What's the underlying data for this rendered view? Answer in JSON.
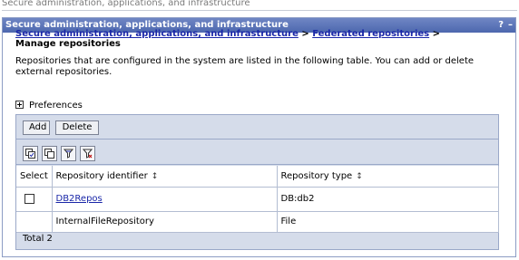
{
  "page": {
    "outer_title": "Secure administration, applications, and infrastructure"
  },
  "portlet": {
    "header_title": "Secure administration, applications, and infrastructure",
    "help_label": "?",
    "minimize_label": "–"
  },
  "breadcrumb": {
    "link1": "Secure administration, applications, and infrastructure",
    "sep1": " > ",
    "link2": "Federated repositories",
    "sep2": " > ",
    "current": "Manage repositories"
  },
  "description": "Repositories that are configured in the system are listed in the following table. You can add or delete external repositories.",
  "preferences_label": "Preferences",
  "buttons": {
    "add": "Add",
    "delete": "Delete"
  },
  "toolbar_icons": [
    "select-all-icon",
    "deselect-all-icon",
    "show-filter-icon",
    "clear-filter-icon"
  ],
  "table": {
    "columns": [
      "Select",
      "Repository identifier",
      "Repository type"
    ],
    "rows": [
      {
        "selectable": true,
        "identifier": "DB2Repos",
        "identifier_is_link": true,
        "type": "DB:db2"
      },
      {
        "selectable": false,
        "identifier": "InternalFileRepository",
        "identifier_is_link": false,
        "type": "File"
      }
    ],
    "total_label": "Total 2"
  },
  "colors": {
    "header_bg": "#5a72b6",
    "link": "#1a27a8",
    "table_bg": "#d5dcea"
  }
}
